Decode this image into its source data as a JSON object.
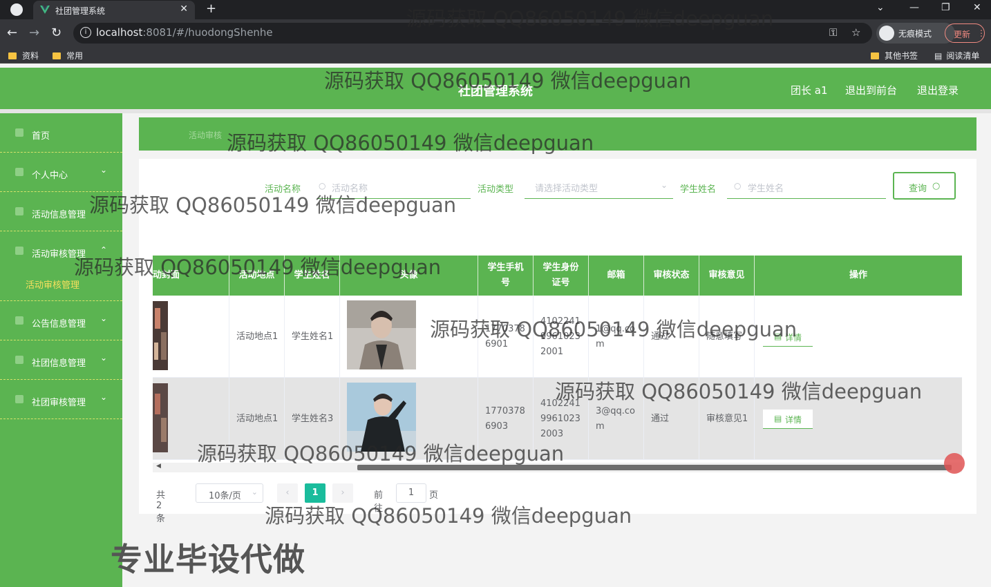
{
  "browser": {
    "tab_title": "社团管理系统",
    "url_host": "localhost",
    "url_path": ":8081/#/huodongShenhe",
    "incognito_label": "无痕模式",
    "update_label": "更新",
    "bookmarks": [
      "资料",
      "常用"
    ],
    "bookmarks_right": [
      "其他书签",
      "阅读清单"
    ]
  },
  "header": {
    "title": "社团管理系统",
    "user": "团长 a1",
    "to_front": "退出到前台",
    "logout": "退出登录"
  },
  "sidebar": {
    "items": [
      {
        "label": "首页",
        "icon": "home-icon",
        "expandable": false
      },
      {
        "label": "个人中心",
        "icon": "user-icon",
        "expandable": true
      },
      {
        "label": "活动信息管理",
        "icon": "grid-icon",
        "expandable": false
      },
      {
        "label": "活动审核管理",
        "icon": "grid-icon",
        "expandable": true,
        "expanded": true
      },
      {
        "label": "公告信息管理",
        "icon": "grid-icon",
        "expandable": true
      },
      {
        "label": "社团信息管理",
        "icon": "user-icon",
        "expandable": true
      },
      {
        "label": "社团审核管理",
        "icon": "check-icon",
        "expandable": true
      }
    ],
    "submenu_active": "活动审核管理"
  },
  "breadcrumb": "活动审核",
  "search": {
    "activity_name_label": "活动名称",
    "activity_name_placeholder": "活动名称",
    "activity_type_label": "活动类型",
    "activity_type_placeholder": "请选择活动类型",
    "student_name_label": "学生姓名",
    "student_name_placeholder": "学生姓名",
    "query_label": "查询"
  },
  "table": {
    "headers": [
      "动封面",
      "活动地点",
      "学生姓名",
      "头像",
      "学生手机号",
      "学生身份证号",
      "邮箱",
      "审核状态",
      "审核意见",
      "操作"
    ],
    "rows": [
      {
        "location": "活动地点1",
        "student": "学生姓名1",
        "phone": "17703786901",
        "idcard": "410224199610232001",
        "email": "1@qq.com",
        "status": "通过",
        "opinion": "随意填写",
        "action": "详情"
      },
      {
        "location": "活动地点1",
        "student": "学生姓名3",
        "phone": "17703786903",
        "idcard": "410224199610232003",
        "email": "3@qq.com",
        "status": "通过",
        "opinion": "审核意见1",
        "action": "详情"
      }
    ]
  },
  "pager": {
    "total": "共 2 条",
    "page_size": "10条/页",
    "prev": "‹",
    "current": "1",
    "next": "›",
    "goto": "前往",
    "goto_value": "1",
    "page_unit": "页"
  },
  "watermarks": {
    "repeat": "源码获取 QQ86050149 微信deepguan",
    "big": "专业毕设代做"
  }
}
